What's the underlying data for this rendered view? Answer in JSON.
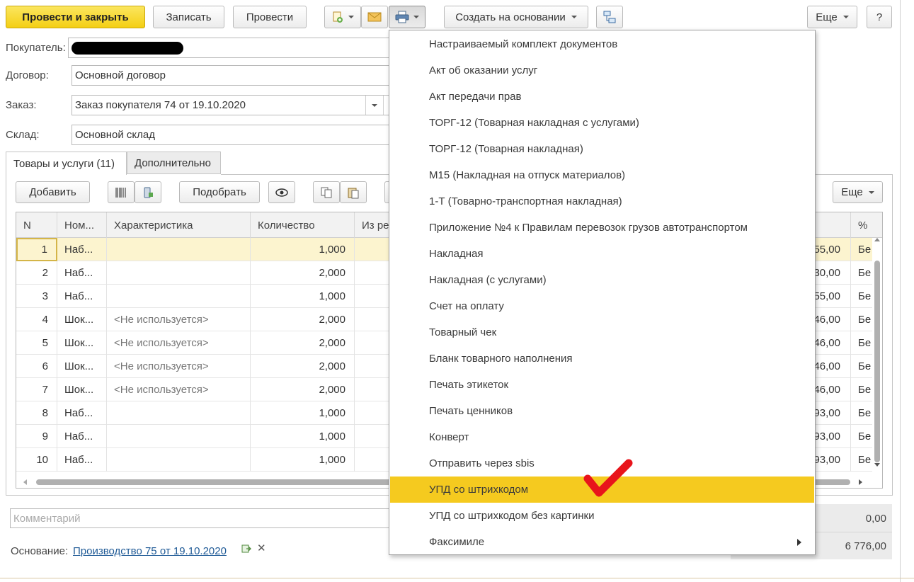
{
  "toolbar": {
    "post_close": "Провести и закрыть",
    "save": "Записать",
    "post": "Провести",
    "create_based": "Создать на основании",
    "more": "Еще",
    "help": "?"
  },
  "form": {
    "buyer_label": "Покупатель:",
    "contract_label": "Договор:",
    "contract_value": "Основной договор",
    "order_label": "Заказ:",
    "order_value": "Заказ покупателя 74 от 19.10.2020",
    "warehouse_label": "Склад:",
    "warehouse_value": "Основной склад"
  },
  "tabs": [
    "Товары и услуги (11)",
    "Дополнительно"
  ],
  "table_toolbar": {
    "add": "Добавить",
    "pick": "Подобрать",
    "more": "Еще"
  },
  "table": {
    "headers": [
      "N",
      "Ном...",
      "Характеристика",
      "Количество",
      "Из ре",
      "%"
    ],
    "rows": [
      {
        "n": "1",
        "name": "Наб...",
        "char": "",
        "qty": "1,000",
        "sum": "55,00",
        "vat": "Бе"
      },
      {
        "n": "2",
        "name": "Наб...",
        "char": "",
        "qty": "2,000",
        "sum": "30,00",
        "vat": "Бе"
      },
      {
        "n": "3",
        "name": "Наб...",
        "char": "",
        "qty": "1,000",
        "sum": "55,00",
        "vat": "Бе"
      },
      {
        "n": "4",
        "name": "Шок...",
        "char": "<Не используется>",
        "qty": "2,000",
        "sum": "46,00",
        "vat": "Бе"
      },
      {
        "n": "5",
        "name": "Шок...",
        "char": "<Не используется>",
        "qty": "2,000",
        "sum": "46,00",
        "vat": "Бе"
      },
      {
        "n": "6",
        "name": "Шок...",
        "char": "<Не используется>",
        "qty": "2,000",
        "sum": "46,00",
        "vat": "Бе"
      },
      {
        "n": "7",
        "name": "Шок...",
        "char": "<Не используется>",
        "qty": "2,000",
        "sum": "46,00",
        "vat": "Бе"
      },
      {
        "n": "8",
        "name": "Наб...",
        "char": "",
        "qty": "1,000",
        "sum": "93,00",
        "vat": "Бе"
      },
      {
        "n": "9",
        "name": "Наб...",
        "char": "",
        "qty": "1,000",
        "sum": "93,00",
        "vat": "Бе"
      },
      {
        "n": "10",
        "name": "Наб...",
        "char": "",
        "qty": "1,000",
        "sum": "93,00",
        "vat": "Бе"
      }
    ]
  },
  "footer": {
    "comment_placeholder": "Комментарий",
    "basis_label": "Основание:",
    "basis_link": "Производство 75 от 19.10.2020",
    "total_vat": "0,00",
    "total_sum": "6 776,00"
  },
  "print_menu": {
    "items": [
      "Настраиваемый комплект документов",
      "Акт об оказании услуг",
      "Акт передачи прав",
      "ТОРГ-12 (Товарная накладная с услугами)",
      "ТОРГ-12 (Товарная накладная)",
      "М15 (Накладная на отпуск материалов)",
      "1-Т (Товарно-транспортная накладная)",
      "Приложение №4 к Правилам перевозок грузов автотранспортом",
      "Накладная",
      "Накладная (с услугами)",
      "Счет на оплату",
      "Товарный чек",
      "Бланк товарного наполнения",
      "Печать этикеток",
      "Печать ценников",
      "Конверт",
      "Отправить через sbis",
      "УПД со штрихкодом",
      "УПД со штрихкодом без картинки",
      "Факсимиле"
    ],
    "highlighted_index": 17
  },
  "colors": {
    "accent_yellow": "#f5ca1f",
    "checkmark_red": "#e8141b",
    "selected_row": "#fcf4cf",
    "link_blue": "#1f5a96"
  }
}
